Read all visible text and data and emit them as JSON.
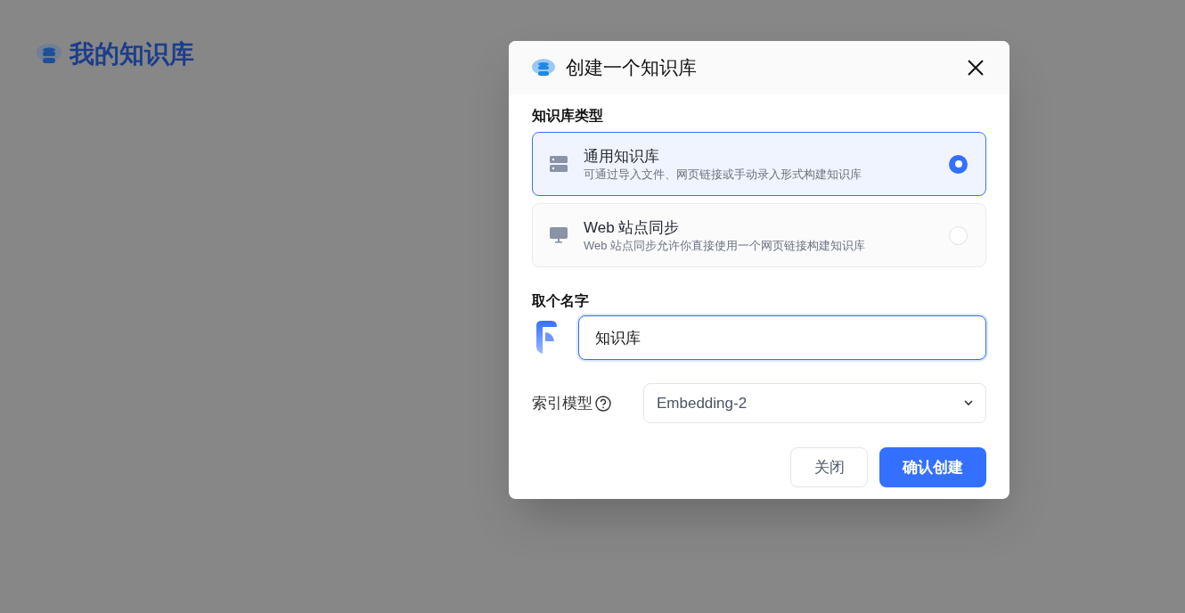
{
  "page": {
    "title": "我的知识库"
  },
  "dialog": {
    "title": "创建一个知识库",
    "type_section": {
      "label": "知识库类型",
      "options": [
        {
          "kind": "server",
          "title": "通用知识库",
          "description": "可通过导入文件、网页链接或手动录入形式构建知识库",
          "selected": true
        },
        {
          "kind": "monitor",
          "title": "Web 站点同步",
          "description": "Web 站点同步允许你直接使用一个网页链接构建知识库",
          "selected": false
        }
      ]
    },
    "name_section": {
      "label": "取个名字",
      "value": "知识库"
    },
    "index_model": {
      "label": "索引模型",
      "value": "Embedding-2"
    },
    "buttons": [
      {
        "kind": "secondary",
        "label": "关闭"
      },
      {
        "kind": "primary",
        "label": "确认创建"
      }
    ]
  }
}
